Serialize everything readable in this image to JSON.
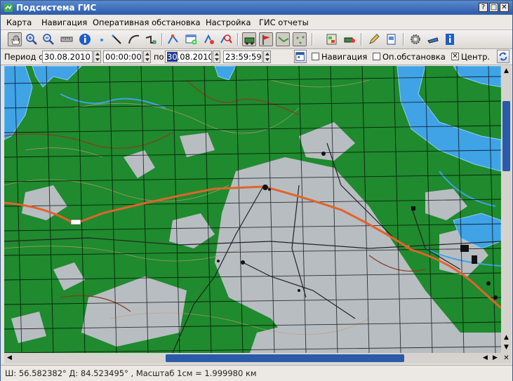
{
  "window": {
    "title": "Подсистема ГИС",
    "buttons": [
      "?",
      "□",
      "✕"
    ]
  },
  "menu": [
    "Карта",
    "Навигация",
    "Оперативная обстановка",
    "Настройка",
    "ГИС отчеты"
  ],
  "toolbar": {
    "tools": [
      "pan-hand-icon",
      "zoom-in-icon",
      "zoom-out-icon",
      "measure-ruler-icon",
      "info-icon",
      "point-icon",
      "draw-line-icon",
      "draw-arc-icon",
      "draw-polyline-icon",
      "route-icon",
      "map-add-icon",
      "object-move-icon",
      "object-search-icon",
      "vehicle-green-icon",
      "vehicle-red-icon",
      "track-icon",
      "dots-icon",
      "layers-icon",
      "layer-vehicle-icon",
      "edit-icon",
      "print-icon",
      "settings-gear-icon",
      "cloud-icon",
      "info-panel-icon"
    ]
  },
  "period": {
    "label": "Период с",
    "from_date": "30.08.2010",
    "from_time": "00:00:00",
    "to_label": "по",
    "to_date_selected": "30",
    "to_date_rest": ".08.2010",
    "to_time": "23:59:59",
    "checkboxes": [
      {
        "label": "Навигация",
        "checked": false
      },
      {
        "label": "Оп.обстановка",
        "checked": false
      },
      {
        "label": "Центр.",
        "checked": true
      }
    ]
  },
  "map": {
    "water": "#3fa3e6",
    "forest": "#1f8a2e",
    "field": "#b9bec4",
    "road": "#e0642a"
  },
  "status": {
    "text": "Ш: 56.582382°  Д: 84.523495° , Масштаб 1см = 1.999980 км"
  }
}
